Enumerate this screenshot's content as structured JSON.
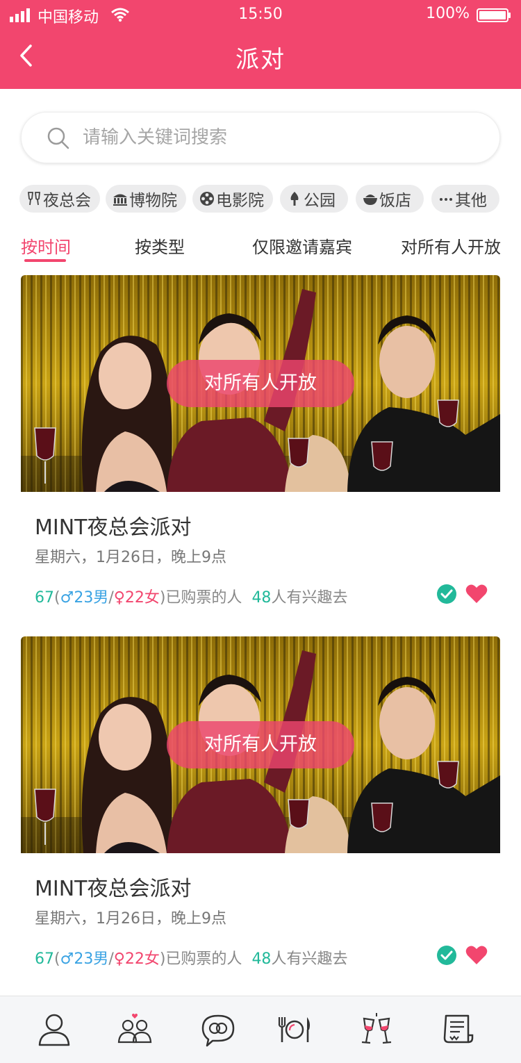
{
  "status_bar": {
    "carrier": "中国移动",
    "time": "15:50",
    "battery": "100%"
  },
  "header": {
    "title": "派对"
  },
  "search": {
    "placeholder": "请输入关键词搜索"
  },
  "categories": [
    {
      "label": "夜总会",
      "icon": "glasses-icon"
    },
    {
      "label": "博物院",
      "icon": "museum-icon"
    },
    {
      "label": "电影院",
      "icon": "film-reel-icon"
    },
    {
      "label": "公园",
      "icon": "tree-icon"
    },
    {
      "label": "饭店",
      "icon": "rice-bowl-icon"
    },
    {
      "label": "其他",
      "icon": "more-icon"
    }
  ],
  "tabs": [
    {
      "label": "按时间",
      "active": true
    },
    {
      "label": "按类型",
      "active": false
    },
    {
      "label": "仅限邀请嘉宾",
      "active": false
    },
    {
      "label": "对所有人开放",
      "active": false
    }
  ],
  "events": [
    {
      "badge": "对所有人开放",
      "title": "MINT夜总会派对",
      "date": "星期六，1月26日，晚上9点",
      "total": "67",
      "male": "♂23男",
      "female": "♀22女",
      "purchased_label": ")已购票的人",
      "interested_count": "48",
      "interested_label": "人有兴趣去"
    },
    {
      "badge": "对所有人开放",
      "title": "MINT夜总会派对",
      "date": "星期六，1月26日，晚上9点",
      "total": "67",
      "male": "♂23男",
      "female": "♀22女",
      "purchased_label": ")已购票的人",
      "interested_count": "48",
      "interested_label": "人有兴趣去"
    }
  ],
  "bottom_nav": [
    {
      "icon": "profile-icon"
    },
    {
      "icon": "couple-icon"
    },
    {
      "icon": "chat-rings-icon"
    },
    {
      "icon": "dining-icon"
    },
    {
      "icon": "party-glasses-icon"
    },
    {
      "icon": "document-icon"
    }
  ],
  "colors": {
    "brand": "#f2466e",
    "green": "#22b99a",
    "blue": "#3aa3e3",
    "gold_background": "#b8960a"
  }
}
